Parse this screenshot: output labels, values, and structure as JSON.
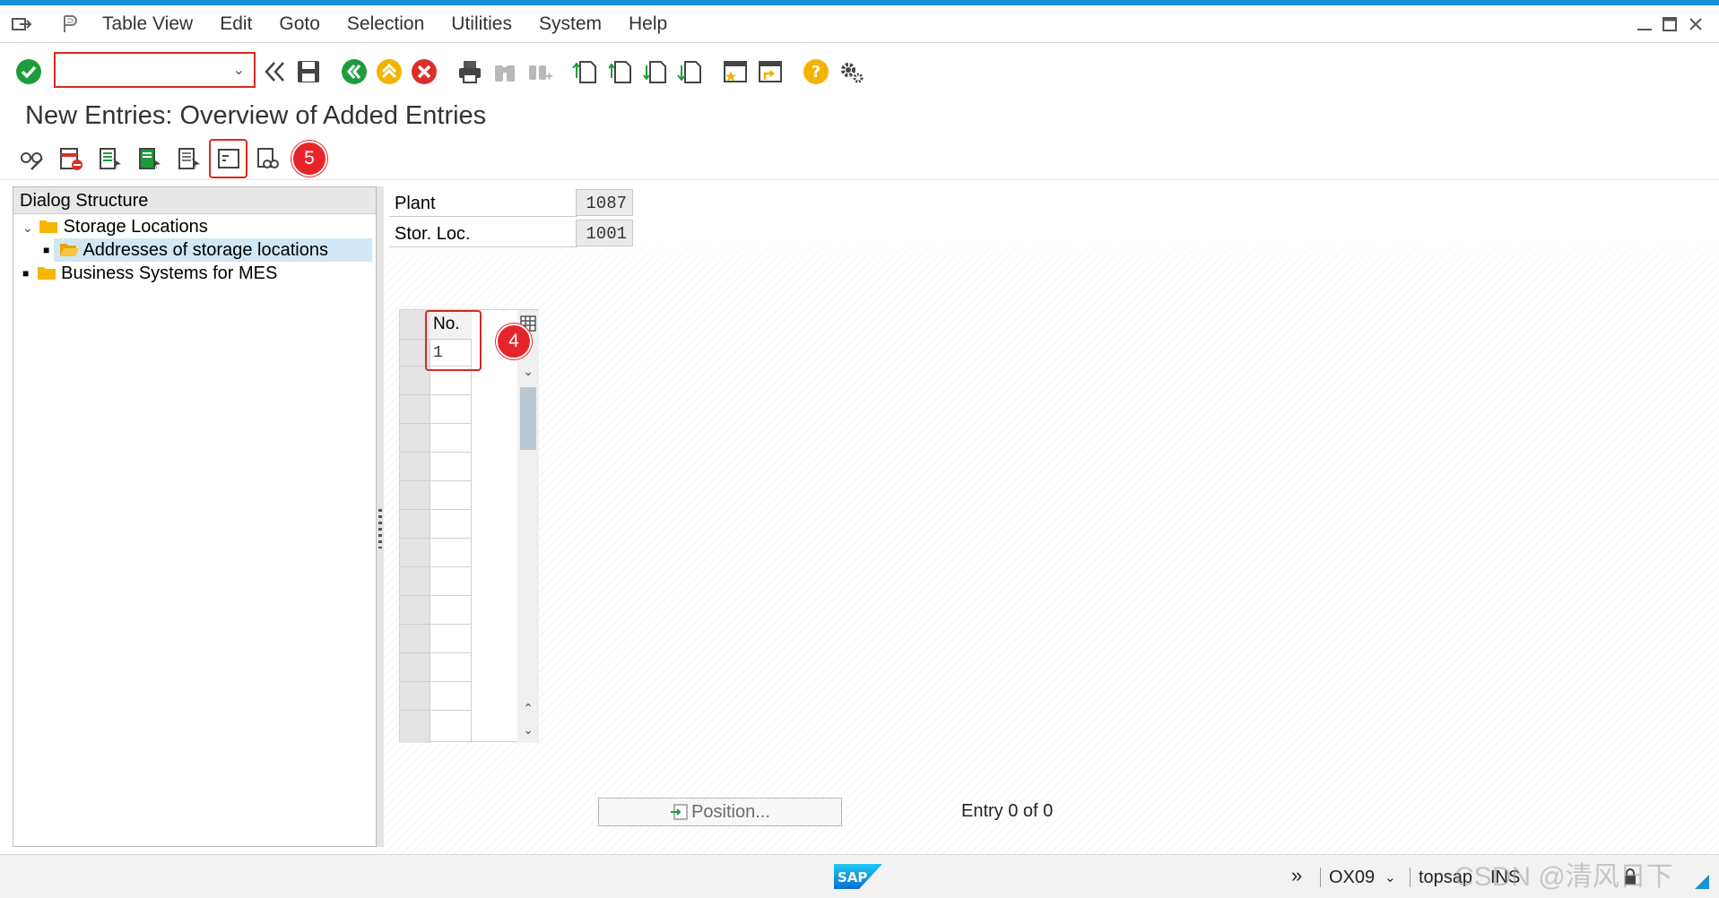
{
  "menubar": {
    "items": [
      {
        "label": "Table View"
      },
      {
        "label": "Edit"
      },
      {
        "label": "Goto"
      },
      {
        "label": "Selection"
      },
      {
        "label": "Utilities"
      },
      {
        "label": "System"
      },
      {
        "label": "Help"
      }
    ]
  },
  "toolbar": {
    "command_value": ""
  },
  "title": "New Entries: Overview of Added Entries",
  "markers": {
    "five": "5",
    "four": "4"
  },
  "dialog": {
    "header": "Dialog Structure",
    "items": [
      {
        "label": "Storage Locations"
      },
      {
        "label": "Addresses of storage locations"
      },
      {
        "label": "Business Systems for MES"
      }
    ]
  },
  "fields": {
    "plant_label": "Plant",
    "plant_value": "1087",
    "storloc_label": "Stor. Loc.",
    "storloc_value": "1001"
  },
  "table": {
    "header": "No.",
    "rows": [
      "1"
    ]
  },
  "position_button": "Position...",
  "entry_text": "Entry 0 of 0",
  "status": {
    "system": "OX09",
    "user": "topsap",
    "mode": "INS"
  },
  "colors": {
    "accent": "#1a8fd6",
    "marker_red": "#e8242b",
    "ok_green": "#1e9c3c",
    "cancel_red": "#d9302a",
    "exit_yellow": "#f2b400",
    "folder_yellow": "#f7b500"
  },
  "watermark": "CSDN @清风日下"
}
